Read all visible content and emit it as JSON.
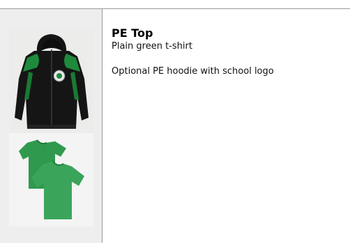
{
  "product": {
    "title": "PE Top",
    "description_line_1": "Plain green t-shirt",
    "description_line_2": "Optional PE hoodie with school logo"
  },
  "images": {
    "hoodie": "pe-hoodie-image",
    "tshirt": "green-tshirt-image"
  },
  "colors": {
    "accent_green": "#1f8a3c",
    "hoodie_black": "#151515",
    "tshirt_green": "#3aa55a",
    "border": "#9a9a9a",
    "sidebar_bg": "#eeeeee"
  }
}
